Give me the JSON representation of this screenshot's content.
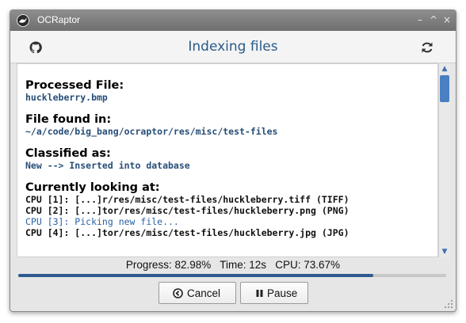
{
  "window": {
    "title": "OCRaptor",
    "controls": [
      "minimize",
      "maximize",
      "close"
    ]
  },
  "header": {
    "title": "Indexing files",
    "left_icon": "github-icon",
    "right_icon": "refresh-icon"
  },
  "content": {
    "processed_label": "Processed File:",
    "processed_value": "huckleberry.bmp",
    "found_label": "File found in:",
    "found_value": "~/a/code/big_bang/ocraptor/res/misc/test-files",
    "classified_label": "Classified as:",
    "classified_value": "New --> Inserted into database",
    "looking_label": "Currently looking at:",
    "cpus": [
      "CPU [1]: [...]r/res/misc/test-files/huckleberry.tiff (TIFF)",
      "CPU [2]: [...]tor/res/misc/test-files/huckleberry.png (PNG)",
      "CPU [3]: Picking new file...",
      "CPU [4]: [...]tor/res/misc/test-files/huckleberry.jpg (JPG)"
    ]
  },
  "status": {
    "text": "Progress: 82.98%   Time: 12s   CPU: 73.67%",
    "progress": 0.8298
  },
  "buttons": {
    "cancel_label": "Cancel",
    "pause_label": "Pause"
  },
  "colors": {
    "accent": "#2d5a8f",
    "title_text": "#2a5a88"
  }
}
